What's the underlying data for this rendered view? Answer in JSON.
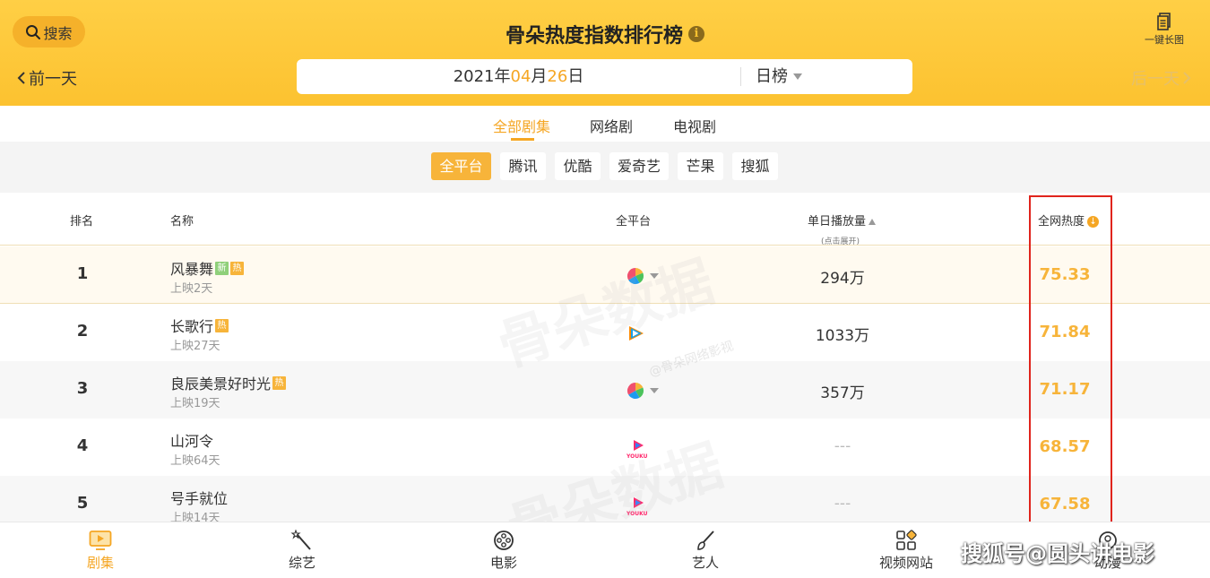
{
  "header": {
    "search_label": "搜索",
    "title": "骨朵热度指数排行榜",
    "info_icon": "i",
    "longpic_label": "一键长图",
    "prev_day": "前一天",
    "next_day": "后一天",
    "date": {
      "year": "2021",
      "year_unit": "年",
      "month": "04",
      "month_unit": "月",
      "day": "26",
      "day_unit": "日"
    },
    "rank_type": "日榜"
  },
  "category_tabs": [
    "全部剧集",
    "网络剧",
    "电视剧"
  ],
  "active_category": "全部剧集",
  "platform_chips": [
    "全平台",
    "腾讯",
    "优酷",
    "爱奇艺",
    "芒果",
    "搜狐"
  ],
  "active_platform": "全平台",
  "table_header": {
    "rank": "排名",
    "name": "名称",
    "platform": "全平台",
    "daily_plays": "单日播放量",
    "daily_plays_hint": "(点击展开)",
    "heat": "全网热度"
  },
  "rows": [
    {
      "rank": "1",
      "name": "风暴舞",
      "tags": [
        "新",
        "热"
      ],
      "days": "上映2天",
      "platform": "multi",
      "plays": "294万",
      "heat": "75.33"
    },
    {
      "rank": "2",
      "name": "长歌行",
      "tags": [
        "热"
      ],
      "days": "上映27天",
      "platform": "tencent",
      "plays": "1033万",
      "heat": "71.84"
    },
    {
      "rank": "3",
      "name": "良辰美景好时光",
      "tags": [
        "热"
      ],
      "days": "上映19天",
      "platform": "multi",
      "plays": "357万",
      "heat": "71.17"
    },
    {
      "rank": "4",
      "name": "山河令",
      "tags": [],
      "days": "上映64天",
      "platform": "youku",
      "plays": "---",
      "heat": "68.57"
    },
    {
      "rank": "5",
      "name": "号手就位",
      "tags": [],
      "days": "上映14天",
      "platform": "youku",
      "plays": "---",
      "heat": "67.58"
    }
  ],
  "watermark": {
    "brand": "骨朵数据",
    "sub": "@骨朵网络影视"
  },
  "bottom_nav": [
    "剧集",
    "综艺",
    "电影",
    "艺人",
    "视频网站",
    "动漫"
  ],
  "active_nav": "剧集",
  "source_watermark": "搜狐号@圆头讲电影",
  "colors": {
    "header_bg": "#fcc230",
    "accent": "#f5a623",
    "heat": "#f7b43a",
    "highlight_box": "#e0241c"
  }
}
